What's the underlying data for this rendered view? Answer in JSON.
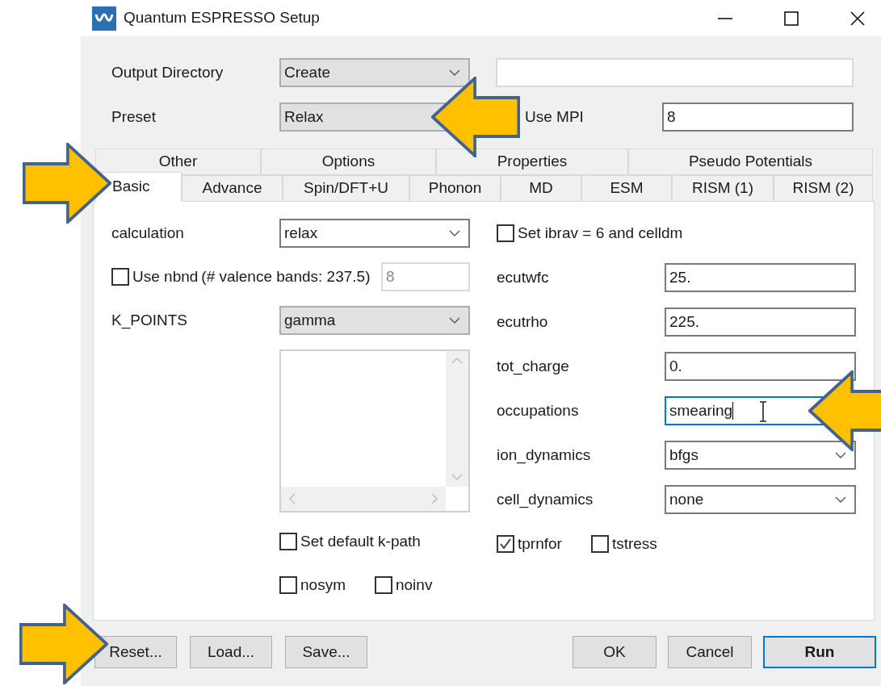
{
  "window": {
    "title": "Quantum ESPRESSO Setup"
  },
  "output_directory": {
    "label": "Output Directory",
    "value": "Create"
  },
  "preset": {
    "label": "Preset",
    "value": "Relax",
    "callout": {
      "kind": "left"
    }
  },
  "mpi": {
    "label": "Use MPI",
    "value": "8"
  },
  "tabs_row_1": [
    {
      "label": "Other",
      "selected": false
    },
    {
      "label": "Options",
      "selected": false
    },
    {
      "label": "Properties",
      "selected": false
    },
    {
      "label": "Pseudo Potentials",
      "selected": false
    }
  ],
  "tabs_row_2": [
    {
      "label": "Basic",
      "selected": true,
      "callout": {
        "kind": "right"
      }
    },
    {
      "label": "Advance",
      "selected": false
    },
    {
      "label": "Spin/DFT+U",
      "selected": false
    },
    {
      "label": "Phonon",
      "selected": false
    },
    {
      "label": "MD",
      "selected": false
    },
    {
      "label": "ESM",
      "selected": false
    },
    {
      "label": "RISM (1)",
      "selected": false
    },
    {
      "label": "RISM (2)",
      "selected": false
    }
  ],
  "left_rows": [
    {
      "kind": "combo",
      "label": "calculation",
      "value": "relax"
    },
    {
      "kind": "check_field",
      "label": "Use nbnd",
      "note": "(# valence bands: 237.5)",
      "checked": false,
      "value": "8",
      "disabled": true
    },
    {
      "kind": "dropdown",
      "label": "K_POINTS",
      "value": "gamma"
    },
    {
      "kind": "listbox"
    },
    {
      "kind": "checks",
      "items": [
        {
          "label": "Set default k-path",
          "checked": false
        }
      ]
    },
    {
      "kind": "checks",
      "items": [
        {
          "label": "nosym",
          "checked": false
        },
        {
          "label": "noinv",
          "checked": false
        }
      ]
    }
  ],
  "right_rows": [
    {
      "kind": "checks",
      "items": [
        {
          "label": "Set ibrav = 6 and celldm",
          "checked": false
        }
      ]
    },
    {
      "kind": "field",
      "label": "ecutwfc",
      "value": "25.",
      "focused": false
    },
    {
      "kind": "field",
      "label": "ecutrho",
      "value": "225.",
      "focused": false
    },
    {
      "kind": "field",
      "label": "tot_charge",
      "value": "0.",
      "focused": false
    },
    {
      "kind": "field",
      "label": "occupations",
      "value": "smearing",
      "focused": true,
      "callout": {
        "kind": "left"
      }
    },
    {
      "kind": "combo",
      "label": "ion_dynamics",
      "value": "bfgs"
    },
    {
      "kind": "combo",
      "label": "cell_dynamics",
      "value": "none"
    },
    {
      "kind": "checks",
      "items": [
        {
          "label": "tprnfor",
          "checked": true
        },
        {
          "label": "tstress",
          "checked": false
        }
      ]
    }
  ],
  "buttons_left": [
    {
      "label": "Reset...",
      "default": false,
      "callout": {
        "kind": "right"
      }
    },
    {
      "label": "Load...",
      "default": false
    },
    {
      "label": "Save...",
      "default": false
    }
  ],
  "buttons_right": [
    {
      "label": "OK",
      "default": false
    },
    {
      "label": "Cancel",
      "default": false
    },
    {
      "label": "Run",
      "default": true
    }
  ]
}
